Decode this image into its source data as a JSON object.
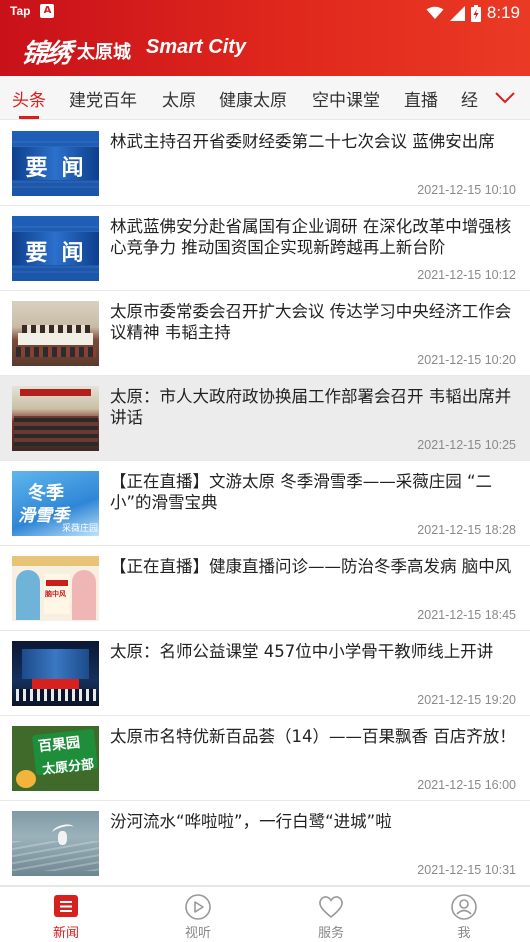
{
  "status_bar": {
    "carrier": "Tap",
    "time": "8:19",
    "icons": [
      "notification-a-icon",
      "wifi-icon",
      "signal-icon",
      "battery-charging-icon"
    ]
  },
  "app_bar": {
    "logo_script": "锦绣",
    "logo_city_cn": "太原城",
    "logo_en": "Smart City"
  },
  "tabs": {
    "items": [
      {
        "label": "头条",
        "active": true
      },
      {
        "label": "建党百年"
      },
      {
        "label": "太原"
      },
      {
        "label": "健康太原"
      },
      {
        "label": "空中课堂"
      },
      {
        "label": "直播"
      },
      {
        "label": "经"
      }
    ],
    "more_icon": "chevron-down-icon"
  },
  "news": [
    {
      "title": "林武主持召开省委财经委第二十七次会议 蓝佛安出席",
      "date": "2021-12-15 10:10",
      "thumb_text": "要闻"
    },
    {
      "title": "林武蓝佛安分赴省属国有企业调研 在深化改革中增强核心竞争力 推动国资国企实现新跨越再上新台阶",
      "date": "2021-12-15 10:12",
      "thumb_text": "要闻"
    },
    {
      "title": "太原市委常委会召开扩大会议 传达学习中央经济工作会议精神 韦韬主持",
      "date": "2021-12-15 10:20"
    },
    {
      "title": "太原：市人大政府政协换届工作部署会召开 韦韬出席并讲话",
      "date": "2021-12-15 10:25"
    },
    {
      "title": "【正在直播】文游太原 冬季滑雪季——采薇庄园 “二小”的滑雪宝典",
      "date": "2021-12-15 18:28",
      "thumb_text_1": "冬季",
      "thumb_text_2": "滑雪季",
      "thumb_text_3": "采薇庄园"
    },
    {
      "title": "【正在直播】健康直播问诊——防治冬季高发病 脑中风",
      "date": "2021-12-15 18:45",
      "thumb_text": "脑中风"
    },
    {
      "title": "太原：名师公益课堂 457位中小学骨干教师线上开讲",
      "date": "2021-12-15 19:20"
    },
    {
      "title": "太原市名特优新百品荟（14）——百果飘香 百店齐放！",
      "date": "2021-12-15 16:00",
      "thumb_text_1": "百果园",
      "thumb_text_2": "太原分部"
    },
    {
      "title": "汾河流水“哗啦啦”，一行白鹭“进城”啦",
      "date": "2021-12-15 10:31"
    }
  ],
  "bottom_nav": {
    "items": [
      {
        "label": "新闻",
        "icon": "news-icon",
        "active": true
      },
      {
        "label": "视听",
        "icon": "play-circle-icon"
      },
      {
        "label": "服务",
        "icon": "heart-icon"
      },
      {
        "label": "我",
        "icon": "user-icon"
      }
    ]
  },
  "colors": {
    "accent": "#d8201e",
    "header_gradient_start": "#c8111a",
    "header_gradient_end": "#ea3a24",
    "text_primary": "#222222",
    "text_secondary": "#8a8a8a",
    "highlight_row": "#ececec"
  }
}
